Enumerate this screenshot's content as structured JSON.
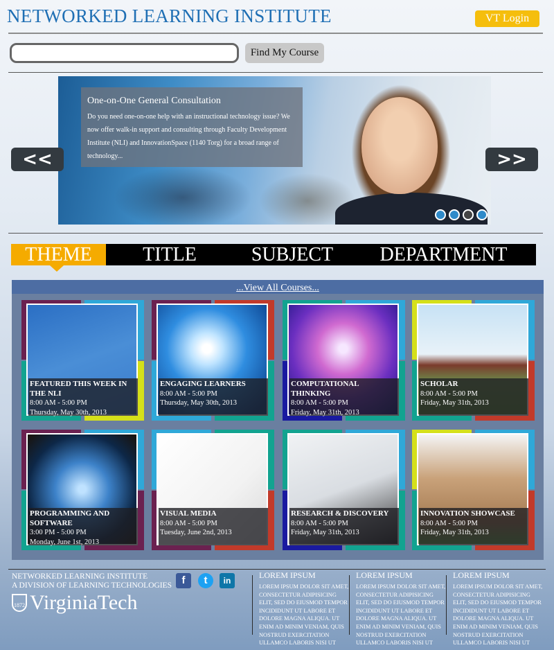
{
  "header": {
    "site_title": "NETWORKED LEARNING INSTITUTE",
    "login_label": "VT Login",
    "search_placeholder": "",
    "search_button": "Find My Course"
  },
  "hero": {
    "title": "One-on-One General Consultation",
    "body": "Do you need one-on-one help with an instructional technology issue? We now offer walk-in support and consulting through Faculty Development Institute (NLI) and InnovationSpace (1140 Torg) for a broad range of technology...",
    "prev_label": "<<",
    "next_label": ">>",
    "slide_count": 4,
    "active_slide": 3
  },
  "tabs": [
    {
      "label": "THEME",
      "active": true
    },
    {
      "label": "TITLE",
      "active": false
    },
    {
      "label": "SUBJECT",
      "active": false
    },
    {
      "label": "DEPARTMENT",
      "active": false
    }
  ],
  "courses_link": "...View All Courses...",
  "courses": [
    {
      "title": "FEATURED THIS WEEK IN THE NLI",
      "time": "8:00 AM - 5:00 PM",
      "date": "Thursday, May 30th, 2013",
      "image": "road-sign-image"
    },
    {
      "title": "ENGAGING LEARNERS",
      "time": "8:00 AM - 5:00 PM",
      "date": "Thursday, May 30th, 2013",
      "image": "light-burst-image"
    },
    {
      "title": "COMPUTATIONAL THINKING",
      "time": "8:00 AM - 5:00 PM",
      "date": "Friday, May 31th, 2013",
      "image": "apple-logo-image"
    },
    {
      "title": "SCHOLAR",
      "time": "8:00 AM - 5:00 PM",
      "date": "Friday, May 31th, 2013",
      "image": "campus-image"
    },
    {
      "title": "PROGRAMMING AND SOFTWARE",
      "time": "3:00 PM - 5:00 PM",
      "date": "Monday, June 1st, 2013",
      "image": "globe-image"
    },
    {
      "title": "VISUAL MEDIA",
      "time": "8:00 AM - 5:00 PM",
      "date": "Tuesday, June 2nd, 2013",
      "image": "media-icons-image"
    },
    {
      "title": "RESEARCH & DISCOVERY",
      "time": "8:00 AM - 5:00 PM",
      "date": "Friday, May 31th, 2013",
      "image": "ipad-image"
    },
    {
      "title": "INNOVATION SHOWCASE",
      "time": "8:00 AM - 5:00 PM",
      "date": "Friday, May 31th, 2013",
      "image": "paper-bag-image"
    }
  ],
  "footer": {
    "institute_line1": "NETWORKED LEARNING INSTITUTE",
    "institute_line2": "A DIVISION OF LEARNING TECHNOLOGIES",
    "university": "VirginiaTech",
    "shield_text": "1872",
    "social": [
      {
        "icon": "facebook-icon",
        "glyph": "f",
        "color": "#3b5998"
      },
      {
        "icon": "twitter-icon",
        "glyph": "t",
        "color": "#1da1f2"
      },
      {
        "icon": "linkedin-icon",
        "glyph": "in",
        "color": "#0e76a8"
      }
    ],
    "columns": [
      {
        "heading": "LOREM IPSUM",
        "text": "Lorem ipsum dolor sit amet, consectetur adipisicing elit, sed do eiusmod tempor incididunt ut labore et dolore magna aliqua. Ut enim ad minim veniam, quis nostrud exercitation ullamco laboris nisi ut"
      },
      {
        "heading": "LOREM IPSUM",
        "text": "Lorem ipsum dolor sit amet, consectetur adipisicing elit, sed do eiusmod tempor incididunt ut labore et dolore magna aliqua. Ut enim ad minim veniam, quis nostrud exercitation ullamco laboris nisi ut"
      },
      {
        "heading": "LOREM IPSUM",
        "text": "Lorem ipsum dolor sit amet, consectetur adipisicing elit, sed do eiusmod tempor incididunt ut labore et dolore magna aliqua. Ut enim ad minim veniam, quis nostrud exercitation ullamco laboris nisi ut"
      }
    ]
  },
  "colors": {
    "brand_blue": "#1f6fb4",
    "accent_gold": "#f5ab00",
    "login_gold": "#f5be0d"
  }
}
